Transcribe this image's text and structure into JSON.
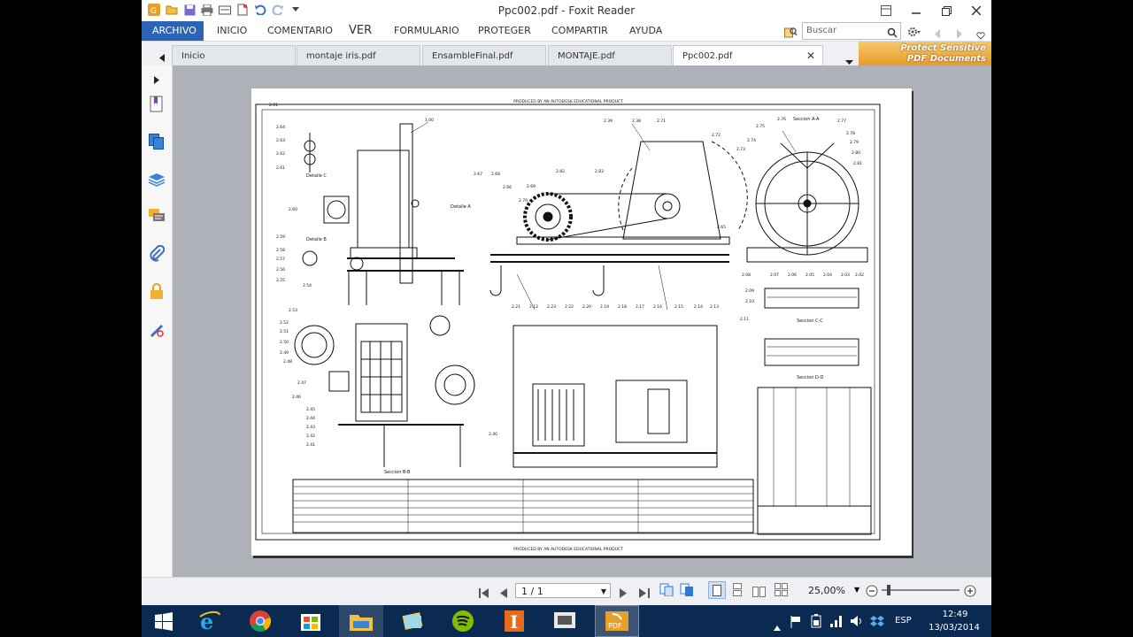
{
  "window": {
    "title": "Ppc002.pdf - Foxit Reader"
  },
  "menu": {
    "items": [
      "ARCHIVO",
      "INICIO",
      "COMENTARIO",
      "VER",
      "FORMULARIO",
      "PROTEGER",
      "COMPARTIR",
      "AYUDA"
    ],
    "search_placeholder": "Buscar"
  },
  "tabs": [
    {
      "label": "Inicio",
      "active": false
    },
    {
      "label": "montaje iris.pdf",
      "active": false
    },
    {
      "label": "EnsambleFinal.pdf",
      "active": false
    },
    {
      "label": "MONTAJE.pdf",
      "active": false
    },
    {
      "label": "Ppc002.pdf",
      "active": true
    }
  ],
  "banner": {
    "line1": "Protect Sensitive",
    "line2": "PDF Documents"
  },
  "sidebar_icons": [
    "bookmark-icon",
    "pages-icon",
    "layers-icon",
    "comments-icon",
    "attachment-icon",
    "security-icon",
    "signature-icon"
  ],
  "drawing": {
    "header_text": "PRODUCED BY AN AUTODESK EDUCATIONAL PRODUCT",
    "footer_text": "PRODUCED BY AN AUTODESK EDUCATIONAL PRODUCT",
    "labels": [
      "Detalle C",
      "Detalle B",
      "Detalle A",
      "Seccion A-A",
      "Seccion B-B",
      "Seccion C-C",
      "Seccion D-D"
    ],
    "callouts": [
      "1.00",
      "2.64",
      "2.63",
      "2.62",
      "2.61",
      "2.60",
      "2.59",
      "2.58",
      "2.57",
      "2.56",
      "2.55",
      "2.54",
      "2.53",
      "2.52",
      "2.51",
      "2.50",
      "2.49",
      "2.48",
      "2.47",
      "2.46",
      "2.45",
      "2.44",
      "2.43",
      "2.42",
      "2.41",
      "2.40",
      "2.39",
      "2.38",
      "2.71",
      "2.72",
      "2.73",
      "2.74",
      "2.75",
      "2.76",
      "2.77",
      "2.78",
      "2.79",
      "2.80",
      "2.81",
      "2.82",
      "2.83",
      "2.69",
      "2.70",
      "2.68",
      "2.67",
      "2.66",
      "2.65",
      "2.21",
      "2.12",
      "2.23",
      "2.22",
      "2.20",
      "2.19",
      "2.18",
      "2.17",
      "2.16",
      "2.15",
      "2.14",
      "2.13",
      "2.11",
      "2.10",
      "2.09",
      "2.08",
      "2.07",
      "2.06",
      "2.05",
      "2.04",
      "2.03",
      "2.02",
      "2.01"
    ]
  },
  "status": {
    "page": "1 / 1",
    "zoom": "25,00%"
  },
  "taskbar": {
    "lang": "ESP",
    "time": "12:49",
    "date": "13/03/2014"
  }
}
